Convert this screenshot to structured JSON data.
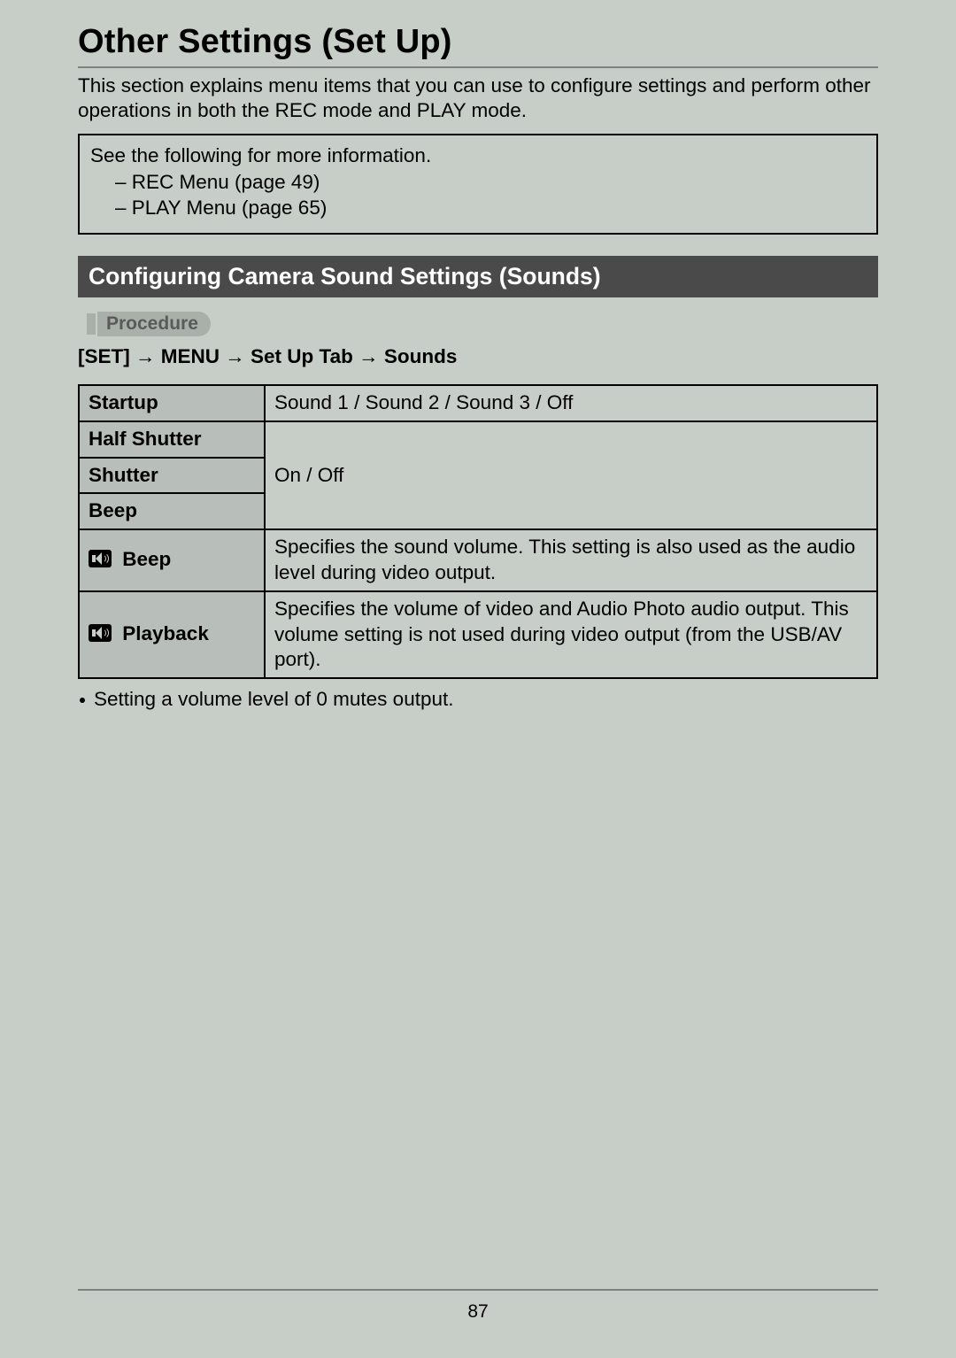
{
  "page_number": "87",
  "heading": "Other Settings (Set Up)",
  "intro": "This section explains menu items that you can use to configure settings and perform other operations in both the REC mode and PLAY mode.",
  "info_box": {
    "lead": "See the following for more information.",
    "items": [
      "–  REC Menu (page 49)",
      "–  PLAY Menu (page 65)"
    ]
  },
  "section_bar": "Configuring Camera Sound Settings (Sounds)",
  "procedure_label": "Procedure",
  "procedure_path": "[SET]  →  MENU  →  Set Up Tab  →  Sounds",
  "table": {
    "rows": [
      {
        "label": "Startup",
        "value": "Sound 1 / Sound 2 / Sound 3 / Off"
      },
      {
        "label": "Half Shutter"
      },
      {
        "label": "Shutter",
        "value": "On / Off"
      },
      {
        "label": "Beep"
      },
      {
        "label": "Beep",
        "icon": "speaker-icon",
        "value": "Specifies the sound volume. This setting is also used as the audio level during video output."
      },
      {
        "label": "Playback",
        "icon": "speaker-icon",
        "value": "Specifies the volume of video and Audio Photo audio output. This volume setting is not used during video output (from the USB/AV port)."
      }
    ]
  },
  "note": "Setting a volume level of 0 mutes output."
}
